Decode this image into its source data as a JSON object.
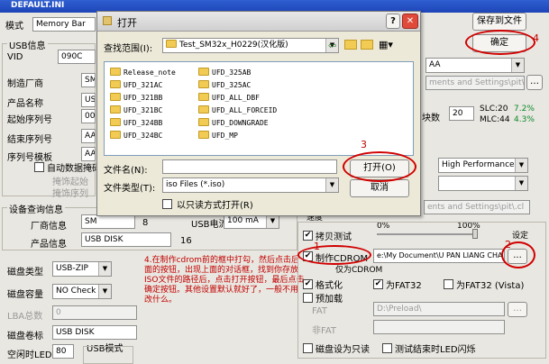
{
  "window": {
    "title": "DEFAULT.INI"
  },
  "top": {
    "mode_label": "模式",
    "mode_value": "Memory Bar",
    "save_to_file": "保存到文件",
    "confirm": "确定",
    "confirm_mark": "4"
  },
  "usb_info": {
    "group": "USB信息",
    "vid_label": "VID",
    "vid_value": "090C",
    "vendor_label": "制造厂商",
    "vendor_value": "SM",
    "product_label": "产品名称",
    "product_value": "US",
    "start_sn_label": "起始序列号",
    "start_sn_value": "000",
    "end_sn_label": "结束序列号",
    "end_sn_value": "AA",
    "sn_template_label": "序列号模板",
    "sn_template_value": "AA",
    "auto_sn_label": "自动数据掩码",
    "mask_start_label": "掩饰起始",
    "mask_range_label": "掩饰序列"
  },
  "device_query": {
    "group": "设备查询信息",
    "vendor_label": "厂商信息",
    "vendor_value": "SM",
    "vendor_num": "8",
    "power_label": "USB电流",
    "power_value": "100 mA",
    "product_label": "产品信息",
    "product_value": "USB DISK",
    "product_num": "16"
  },
  "disk": {
    "type_label": "磁盘类型",
    "type_value": "USB-ZIP",
    "capacity_label": "磁盘容量",
    "capacity_value": "NO Check",
    "lba_label": "LBA总数",
    "lba_value": "0",
    "volume_label": "磁盘卷标",
    "volume_value": "USB DISK",
    "idle_label": "空闲时LED",
    "idle_value": "80",
    "usb_mode_label": "USB模式"
  },
  "right": {
    "dd1_value": "AA",
    "path_value": "ments and Settings\\pit\\",
    "blocks_label": "块数",
    "blocks_value": "20",
    "slc": "SLC:20",
    "slc_pct": "7.2%",
    "mlc": "MLC:44",
    "mlc_pct": "4.3%",
    "perf_value": "High Performance",
    "path2_value": "ents and Settings\\pit\\.cl",
    "spinner_label": "速度",
    "pct0": "0%",
    "pct100": "100%",
    "set_label": "设定",
    "copy_test_label": "拷贝测试",
    "copy_mark": "2",
    "make_cdrom_label": "制作CDROM",
    "cdrom_path": "e:\\My Document\\U PAN LIANG CHA",
    "cdrom_mark": "1",
    "browse": "...",
    "as_cdrom_label": "仅为CDROM",
    "format_label": "格式化",
    "fat32_label": "为FAT32",
    "fat32_vista_label": "为FAT32 (Vista)",
    "preload_label": "预加载",
    "preload_path": "D:\\Preload\\",
    "fat_label": "FAT",
    "nonfat_label": "非FAT",
    "readonly_label": "磁盘设为只读",
    "test_led_label": "测试结束时LED闪烁"
  },
  "annotation": {
    "text": "4.在制作cdrom前的框中打勾，然后点击后面的按钮，出现上面的对话框，找到你存放ISO文件的路径后，点击打开按钮，最后点击确定按钮。其他设置默认就好了，一般不用改什么。"
  },
  "dialog": {
    "title": "打开",
    "help": "?",
    "close": "✕",
    "lookin_label": "查找范围(I):",
    "lookin_value": "Test_SM32x_H0229(汉化版)",
    "files": [
      "Release_note",
      "UFD_321AC",
      "UFD_321BB",
      "UFD_321BC",
      "UFD_324BB",
      "UFD_324BC",
      "UFD_325AB",
      "UFD_325AC",
      "UFD_ALL_DBF",
      "UFD_ALL_FORCEID",
      "UFD_DOWNGRADE",
      "UFD_MP"
    ],
    "filename_label": "文件名(N):",
    "filename_value": "",
    "filetype_label": "文件类型(T):",
    "filetype_value": "iso Files (*.iso)",
    "readonly_label": "以只读方式打开(R)",
    "open": "打开(O)",
    "open_mark": "3",
    "cancel": "取消"
  },
  "colors": {
    "annotation": "#c00000",
    "percent": "#0a8a2a",
    "titlebar": "#1d45b8"
  }
}
